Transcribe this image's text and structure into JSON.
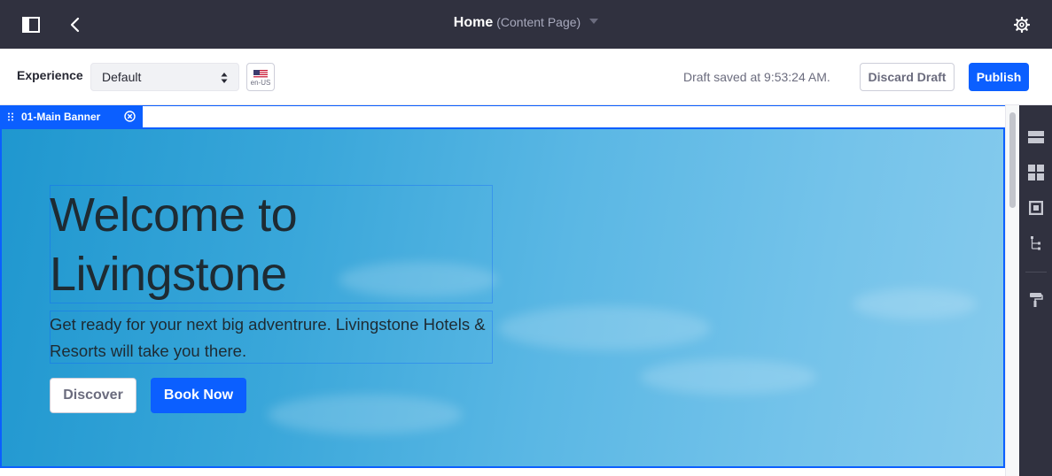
{
  "topbar": {
    "title": "Home",
    "subtitle": "(Content Page)",
    "icons": [
      "sidebar-toggle-icon",
      "back-arrow-icon",
      "settings-gear-icon"
    ]
  },
  "toolbar": {
    "experience_label": "Experience",
    "experience_value": "Default",
    "language": "en-US",
    "draft_status": "Draft saved at 9:53:24 AM.",
    "discard_label": "Discard Draft",
    "publish_label": "Publish"
  },
  "fragment": {
    "name": "01-Main Banner"
  },
  "banner": {
    "heading": "Welcome to Livingstone",
    "paragraph": "Get ready for your next big adventrure. Livingstone Hotels & Resorts will take you there.",
    "primary_button": "Book Now",
    "secondary_button": "Discover"
  },
  "side_panel": {
    "icons": [
      "layouts-icon",
      "fragments-icon",
      "widgets-icon",
      "page-structure-icon",
      "look-and-feel-icon"
    ]
  },
  "colors": {
    "topbar_bg": "#30313f",
    "accent": "#0b5fff",
    "banner_sky": "#3aa7da"
  }
}
